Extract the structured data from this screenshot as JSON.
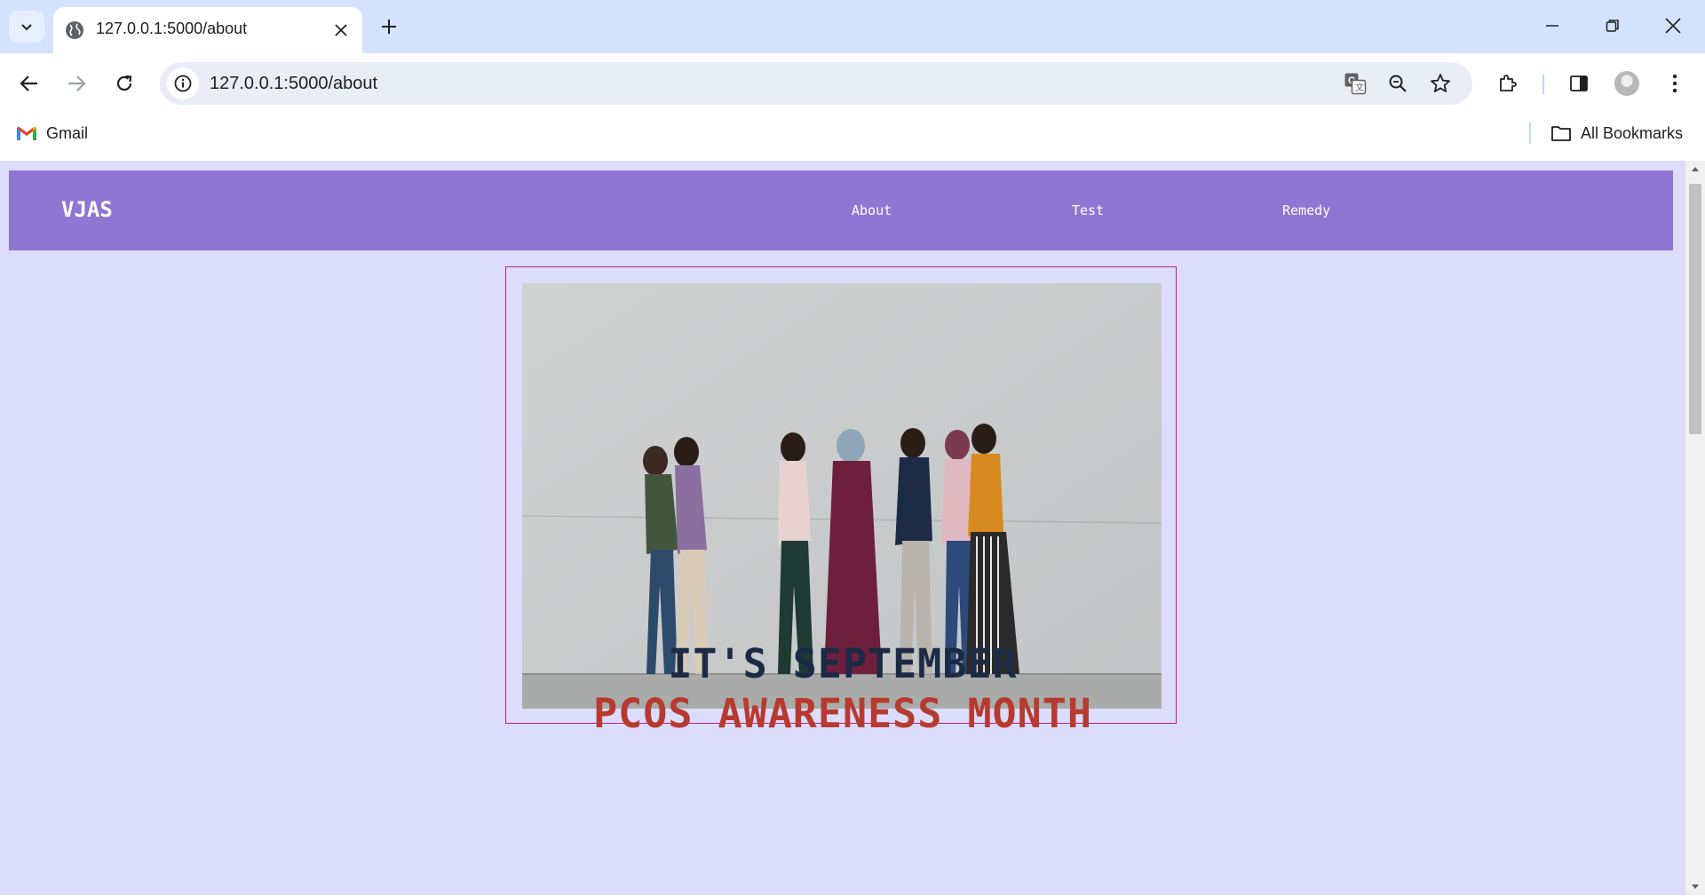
{
  "browser": {
    "tab_title": "127.0.0.1:5000/about",
    "url": "127.0.0.1:5000/about",
    "bookmarks": {
      "gmail": "Gmail",
      "all_bookmarks": "All Bookmarks"
    }
  },
  "site": {
    "logo": "VJAS",
    "nav": {
      "about": "About",
      "test": "Test",
      "remedy": "Remedy"
    },
    "headline_line1": "IT'S SEPTEMBER",
    "headline_line2": "PCOS AWARENESS MONTH"
  },
  "colors": {
    "page_background": "#dcdcfd",
    "nav_background": "#9076d3",
    "frame_border": "#b0208c",
    "headline_primary": "#1b2a45",
    "headline_accent": "#b73a2e"
  },
  "icons": {
    "tab_search": "chevron-down-icon",
    "tab_favicon": "globe-icon",
    "translate": "translate-icon",
    "zoom": "zoom-icon",
    "bookmark": "star-icon",
    "extensions": "puzzle-icon",
    "side_panel": "side-panel-icon",
    "menu": "kebab-menu-icon"
  }
}
